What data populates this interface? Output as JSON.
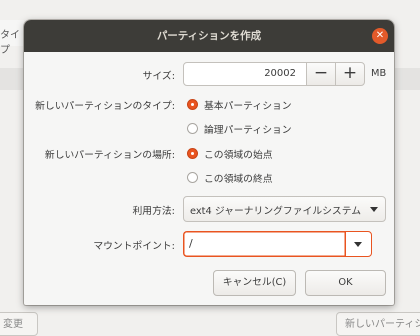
{
  "background": {
    "top_left_fragment": "タイプ",
    "left_button": "変更",
    "right_button": "新しいパーティション"
  },
  "dialog": {
    "title": "パーティションを作成",
    "close_icon": "close-icon",
    "size": {
      "label": "サイズ:",
      "value": "20002",
      "minus": "−",
      "plus": "+",
      "unit": "MB"
    },
    "partition_type": {
      "label": "新しいパーティションのタイプ:",
      "options": [
        "基本パーティション",
        "論理パーティション"
      ],
      "selected": "基本パーティション"
    },
    "location": {
      "label": "新しいパーティションの場所:",
      "options": [
        "この領域の始点",
        "この領域の終点"
      ],
      "selected": "この領域の始点"
    },
    "use_as": {
      "label": "利用方法:",
      "value": "ext4 ジャーナリングファイルシステム"
    },
    "mount_point": {
      "label": "マウントポイント:",
      "value": "/"
    },
    "buttons": {
      "cancel": "キャンセル(C)",
      "ok": "OK"
    },
    "accent_color": "#e95420"
  }
}
